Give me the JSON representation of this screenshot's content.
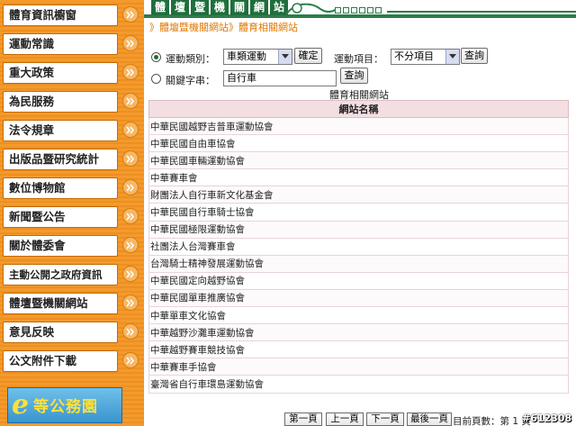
{
  "sidebar": {
    "items": [
      {
        "label": "體育資訊櫥窗"
      },
      {
        "label": "運動常識"
      },
      {
        "label": "重大政策"
      },
      {
        "label": "為民服務"
      },
      {
        "label": "法令規章"
      },
      {
        "label": "出版品暨研究統計"
      },
      {
        "label": "數位博物館"
      },
      {
        "label": "新聞暨公告"
      },
      {
        "label": "關於體委會"
      },
      {
        "label": "主動公開之政府資訊"
      },
      {
        "label": "體壇暨機關網站"
      },
      {
        "label": "意見反映"
      },
      {
        "label": "公文附件下載"
      }
    ],
    "logo_e": "e",
    "logo_text": "等公務園"
  },
  "header": {
    "tabs": [
      "體",
      "壇",
      "暨",
      "機",
      "關",
      "網",
      "站"
    ]
  },
  "breadcrumb": {
    "part1": "》體壇暨機關網站",
    "part2": "》體育相關網站"
  },
  "form": {
    "sport_category_label": "運動類別：",
    "sport_category_value": "車類運動",
    "confirm_button": "確定",
    "sport_item_label": "運動項目：",
    "sport_item_value": "不分項目",
    "search_button": "查詢",
    "keyword_label": "關鍵字串：",
    "keyword_value": "自行車",
    "keyword_search_button": "查詢"
  },
  "caption": "體育相關網站",
  "table": {
    "header": "網站名稱",
    "rows": [
      "中華民國越野吉普車運動協會",
      "中華民國自由車協會",
      "中華民國車輛運動協會",
      "中華賽車會",
      "財團法人自行車新文化基金會",
      "中華民國自行車騎士協會",
      "中華民國極限運動協會",
      "社團法人台灣賽車會",
      "台灣騎士精神發展運動協會",
      "中華民國定向越野協會",
      "中華民國單車推廣協會",
      "中華單車文化協會",
      "中華越野沙灘車運動協會",
      "中華越野賽車競技協會",
      "中華賽車手協會",
      "臺灣省自行車環島運動協會"
    ]
  },
  "pager": {
    "first": "第一頁",
    "prev": "上一頁",
    "next": "下一頁",
    "last": "最後一頁",
    "info": "目前頁數：第 1 頁"
  },
  "watermark": "#612308"
}
